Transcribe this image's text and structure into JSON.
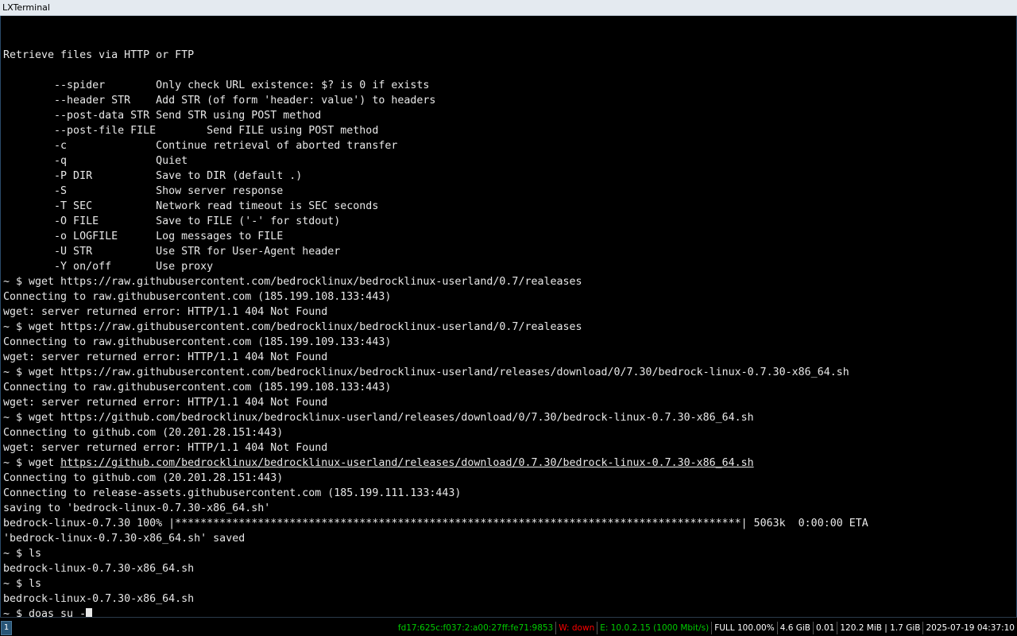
{
  "window": {
    "title": "LXTerminal"
  },
  "terminal": {
    "lines": [
      "",
      "Retrieve files via HTTP or FTP",
      "",
      "        --spider        Only check URL existence: $? is 0 if exists",
      "        --header STR    Add STR (of form 'header: value') to headers",
      "        --post-data STR Send STR using POST method",
      "        --post-file FILE        Send FILE using POST method",
      "        -c              Continue retrieval of aborted transfer",
      "        -q              Quiet",
      "        -P DIR          Save to DIR (default .)",
      "        -S              Show server response",
      "        -T SEC          Network read timeout is SEC seconds",
      "        -O FILE         Save to FILE ('-' for stdout)",
      "        -o LOGFILE      Log messages to FILE",
      "        -U STR          Use STR for User-Agent header",
      "        -Y on/off       Use proxy",
      "~ $ wget https://raw.githubusercontent.com/bedrocklinux/bedrocklinux-userland/0.7/realeases",
      "Connecting to raw.githubusercontent.com (185.199.108.133:443)",
      "wget: server returned error: HTTP/1.1 404 Not Found",
      "~ $ wget https://raw.githubusercontent.com/bedrocklinux/bedrocklinux-userland/0.7/realeases",
      "Connecting to raw.githubusercontent.com (185.199.109.133:443)",
      "wget: server returned error: HTTP/1.1 404 Not Found",
      "~ $ wget https://raw.githubusercontent.com/bedrocklinux/bedrocklinux-userland/releases/download/0/7.30/bedrock-linux-0.7.30-x86_64.sh",
      "Connecting to raw.githubusercontent.com (185.199.108.133:443)",
      "wget: server returned error: HTTP/1.1 404 Not Found",
      "~ $ wget https://github.com/bedrocklinux/bedrocklinux-userland/releases/download/0/7.30/bedrock-linux-0.7.30-x86_64.sh",
      "Connecting to github.com (20.201.28.151:443)",
      "wget: server returned error: HTTP/1.1 404 Not Found"
    ],
    "link_line": {
      "prefix": "~ $ wget ",
      "url": "https://github.com/bedrocklinux/bedrocklinux-userland/releases/download/0.7.30/bedrock-linux-0.7.30-x86_64.sh"
    },
    "lines_after": [
      "Connecting to github.com (20.201.28.151:443)",
      "Connecting to release-assets.githubusercontent.com (185.199.111.133:443)",
      "saving to 'bedrock-linux-0.7.30-x86_64.sh'",
      "bedrock-linux-0.7.30 100% |*****************************************************************************************| 5063k  0:00:00 ETA",
      "'bedrock-linux-0.7.30-x86_64.sh' saved",
      "~ $ ls",
      "bedrock-linux-0.7.30-x86_64.sh",
      "~ $ ls",
      "bedrock-linux-0.7.30-x86_64.sh"
    ],
    "prompt_input": "~ $ doas su -"
  },
  "statusbar": {
    "workspace": "1",
    "ipv6": "fd17:625c:f037:2:a00:27ff:fe71:9853",
    "wireless": "W: down",
    "ethernet": "E: 10.0.2.15 (1000 Mbit/s)",
    "battery": "FULL 100.00%",
    "disk": "4.6 GiB",
    "load": "0.01",
    "memory": "120.2 MiB | 1.7 GiB",
    "datetime": "2025-07-19 04:37:10",
    "colors": {
      "ipv6": "#00cc00",
      "wireless": "#ff0000",
      "ethernet": "#00cc00",
      "default": "#ffffff"
    }
  }
}
